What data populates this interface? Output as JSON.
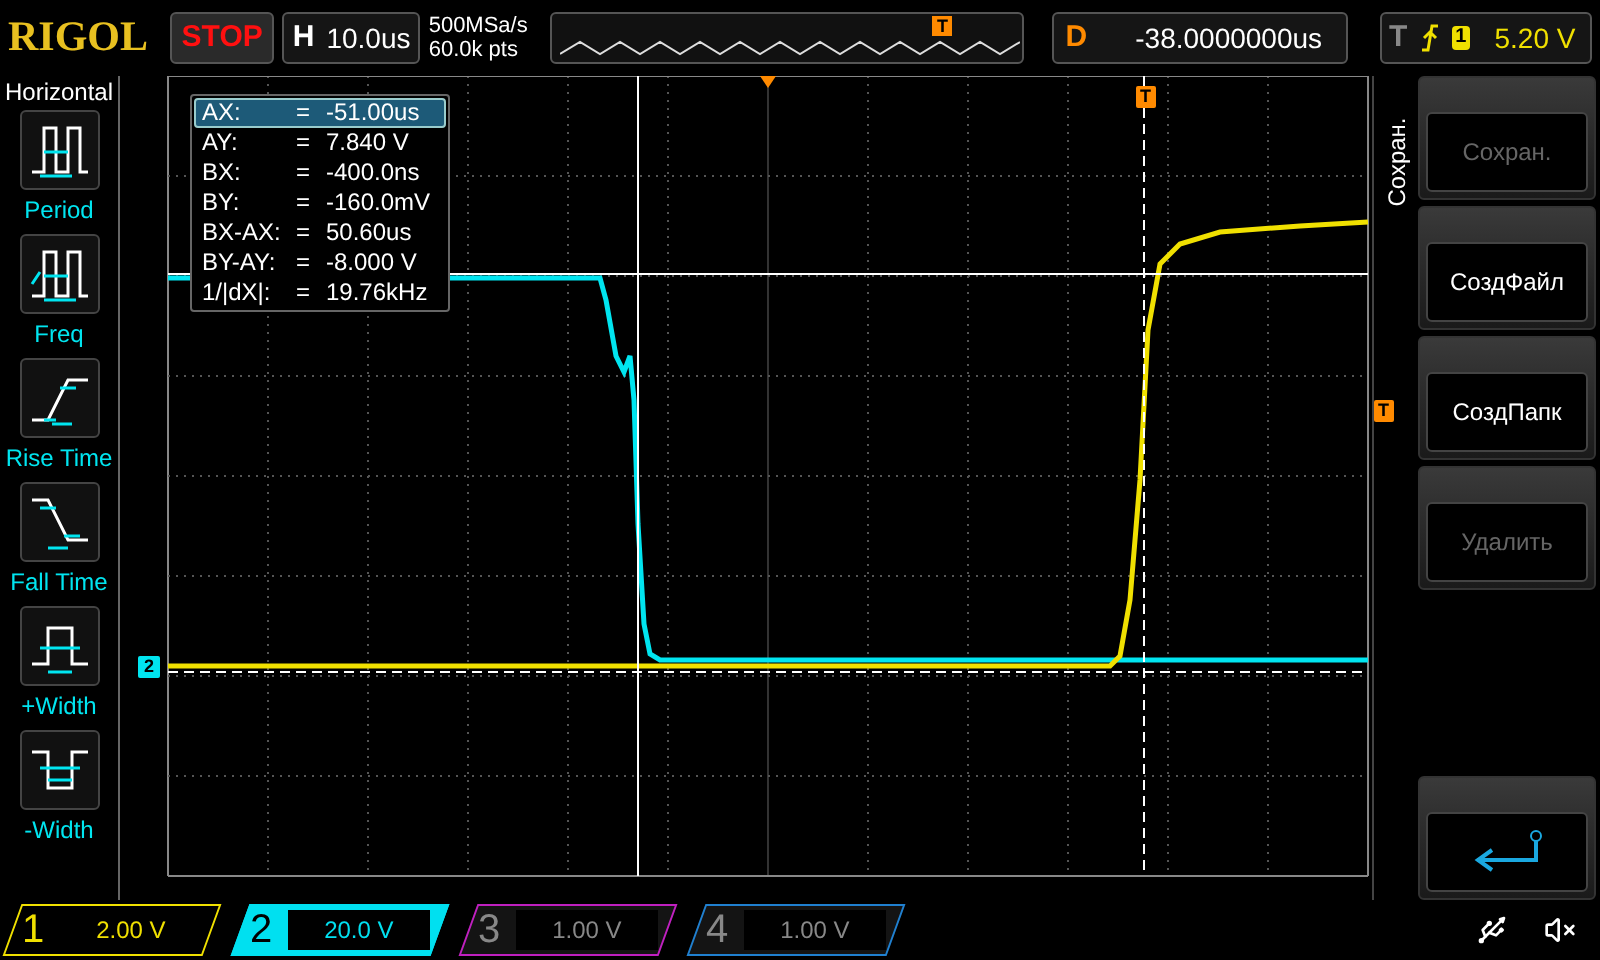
{
  "top_bar": {
    "brand": "RIGOL",
    "run_state": "STOP",
    "horizontal": {
      "label": "H",
      "value": "10.0us"
    },
    "sample_rate": "500MSa/s",
    "memory_depth": "60.0k pts",
    "overview_marker": "T",
    "delay": {
      "label": "D",
      "value": "-38.0000000us"
    },
    "trigger": {
      "label": "T",
      "source": "1",
      "level": "5.20 V"
    }
  },
  "sidebar": {
    "title": "Horizontal",
    "items": [
      {
        "label": "Period",
        "kind": "period"
      },
      {
        "label": "Freq",
        "kind": "freq"
      },
      {
        "label": "Rise Time",
        "kind": "rise"
      },
      {
        "label": "Fall Time",
        "kind": "fall"
      },
      {
        "label": "+Width",
        "kind": "pwidth"
      },
      {
        "label": "-Width",
        "kind": "nwidth"
      }
    ]
  },
  "cursor_readout": [
    {
      "label": "AX:",
      "eq": "=",
      "value": "-51.00us",
      "selected": true
    },
    {
      "label": "AY:",
      "eq": "=",
      "value": "7.840 V",
      "selected": false
    },
    {
      "label": "BX:",
      "eq": "=",
      "value": "-400.0ns",
      "selected": false
    },
    {
      "label": "BY:",
      "eq": "=",
      "value": "-160.0mV",
      "selected": false
    },
    {
      "label": "BX-AX:",
      "eq": "=",
      "value": "50.60us",
      "selected": false
    },
    {
      "label": "BY-AY:",
      "eq": "=",
      "value": "-8.000 V",
      "selected": false
    },
    {
      "label": "1/|dX|:",
      "eq": "=",
      "value": "19.76kHz",
      "selected": false
    }
  ],
  "markers": {
    "trigger_time": "T",
    "trigger_level": "T",
    "channel_2": "2"
  },
  "menu": {
    "title": "Сохран.",
    "buttons": [
      {
        "label": "Сохран.",
        "disabled": true,
        "kind": "text"
      },
      {
        "label": "СоздФайл",
        "disabled": false,
        "kind": "text"
      },
      {
        "label": "СоздПапк",
        "disabled": false,
        "kind": "text"
      },
      {
        "label": "Удалить",
        "disabled": true,
        "kind": "text"
      },
      {
        "kind": "back"
      }
    ]
  },
  "channels": [
    {
      "number": "1",
      "scale": "2.00 V",
      "enabled": true,
      "selected": false,
      "color": "#f0e000"
    },
    {
      "number": "2",
      "scale": "20.0 V",
      "enabled": true,
      "selected": true,
      "color": "#00e0f0"
    },
    {
      "number": "3",
      "scale": "1.00 V",
      "enabled": false,
      "selected": false,
      "color": "#c020c0"
    },
    {
      "number": "4",
      "scale": "1.00 V",
      "enabled": false,
      "selected": false,
      "color": "#2080d0"
    }
  ]
}
